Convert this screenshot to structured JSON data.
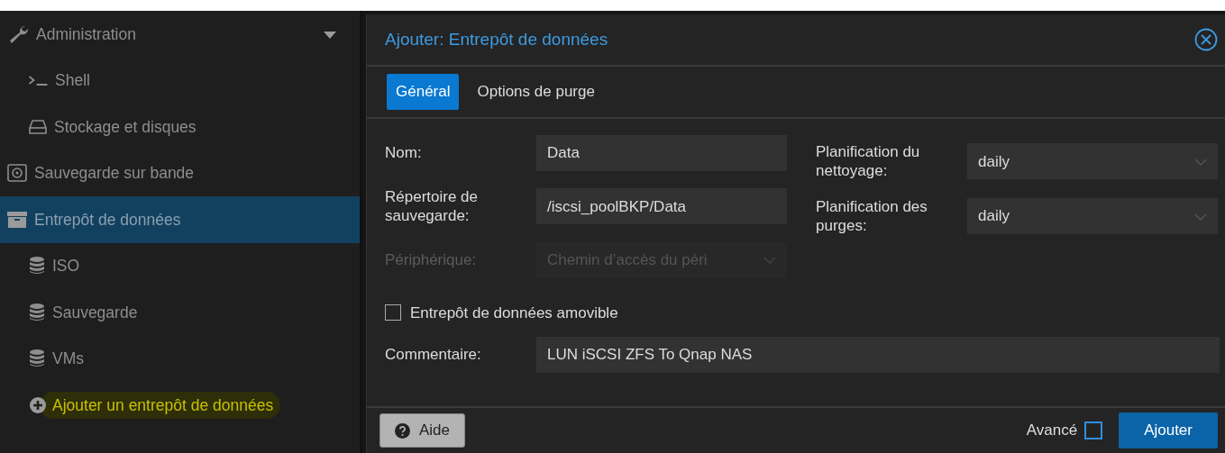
{
  "sidebar": {
    "items": [
      {
        "label": "Administration",
        "kind": "admin",
        "expanded": true,
        "selected": false,
        "children": [
          {
            "label": "Shell",
            "kind": "shell",
            "selected": false
          },
          {
            "label": "Stockage et disques",
            "kind": "disk",
            "selected": false
          }
        ]
      },
      {
        "label": "Sauvegarde sur bande",
        "kind": "tape",
        "selected": false
      },
      {
        "label": "Entrepôt de données",
        "kind": "datastore",
        "selected": true,
        "children": [
          {
            "label": "ISO",
            "kind": "store",
            "selected": false
          },
          {
            "label": "Sauvegarde",
            "kind": "store",
            "selected": false
          },
          {
            "label": "VMs",
            "kind": "store",
            "selected": false
          },
          {
            "label": "Ajouter un entrepôt de données",
            "kind": "add",
            "selected": false,
            "highlighted": true
          }
        ]
      }
    ]
  },
  "dialog": {
    "title": "Ajouter: Entrepôt de données",
    "tabs": [
      {
        "label": "Général",
        "selected": true
      },
      {
        "label": "Options de purge",
        "selected": false
      }
    ],
    "left_fields": [
      {
        "label": "Nom:",
        "kind": "text",
        "value": "Data",
        "disabled": false
      },
      {
        "label": "Répertoire de sauvegarde:",
        "kind": "text",
        "value": "/iscsi_poolBKP/Data",
        "disabled": false
      },
      {
        "label": "Périphérique:",
        "kind": "select",
        "placeholder": "Chemin d’accès du péri",
        "disabled": true
      }
    ],
    "right_fields": [
      {
        "label": "Planification du nettoyage:",
        "kind": "select",
        "value": "daily",
        "disabled": false
      },
      {
        "label": "Planification des purges:",
        "kind": "select",
        "value": "daily",
        "disabled": false
      }
    ],
    "removable": {
      "label": "Entrepôt de données amovible",
      "checked": false
    },
    "comment": {
      "label": "Commentaire:",
      "value": "LUN iSCSI ZFS To Qnap NAS"
    },
    "footer": {
      "help": "Aide",
      "advanced": {
        "label": "Avancé",
        "checked": false
      },
      "submit": "Ajouter"
    }
  }
}
